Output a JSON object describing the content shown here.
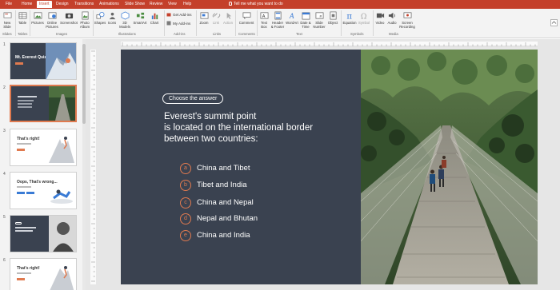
{
  "tabs": [
    "File",
    "Home",
    "Insert",
    "Design",
    "Transitions",
    "Animations",
    "Slide Show",
    "Review",
    "View",
    "Help"
  ],
  "active_tab": "Insert",
  "tell_me": "Tell me what you want to do",
  "ribbon": {
    "new_slide": "New Slide",
    "table": "Table",
    "pictures": "Pictures",
    "online_pictures": "Online Pictures",
    "screenshot": "Screenshot",
    "photo_album": "Photo Album",
    "shapes": "Shapes",
    "icons": "Icons",
    "models_3d": "3D Models",
    "smartart": "SmartArt",
    "chart": "Chart",
    "get_addins": "Get Add-ins",
    "my_addins": "My Add-ins",
    "zoom": "Zoom",
    "link": "Link",
    "action": "Action",
    "comment": "Comment",
    "text_box": "Text Box",
    "header_footer": "Header & Footer",
    "wordart": "WordArt",
    "date_time": "Date & Time",
    "slide_number": "Slide Number",
    "object": "Object",
    "equation": "Equation",
    "symbol": "Symbol",
    "video": "Video",
    "audio": "Audio",
    "screen_recording": "Screen Recording",
    "groups": {
      "slides": "Slides",
      "tables": "Tables",
      "images": "Images",
      "illustrations": "Illustrations",
      "addins": "Add-ins",
      "links": "Links",
      "comments": "Comments",
      "text": "Text",
      "symbols": "Symbols",
      "media": "Media"
    }
  },
  "thumbnails": [
    {
      "num": "1",
      "title": "Mt. Everest Quiz"
    },
    {
      "num": "2",
      "title": ""
    },
    {
      "num": "3",
      "title": "That's right!"
    },
    {
      "num": "4",
      "title": "Oops, That's wrong..."
    },
    {
      "num": "5",
      "title": ""
    },
    {
      "num": "6",
      "title": "That's right!"
    }
  ],
  "slide": {
    "pill": "Choose the answer",
    "question": [
      "Everest's summit point",
      "is located on the international border",
      "between two countries:"
    ],
    "options": [
      {
        "letter": "a",
        "text": "China and Tibet"
      },
      {
        "letter": "b",
        "text": "Tibet and India"
      },
      {
        "letter": "c",
        "text": "China and Nepal"
      },
      {
        "letter": "d",
        "text": "Nepal and Bhutan"
      },
      {
        "letter": "e",
        "text": "China and India"
      }
    ]
  },
  "colors": {
    "ribbon_accent": "#c4402b",
    "slide_bg": "#3a4250",
    "option_accent": "#e07a4f"
  }
}
